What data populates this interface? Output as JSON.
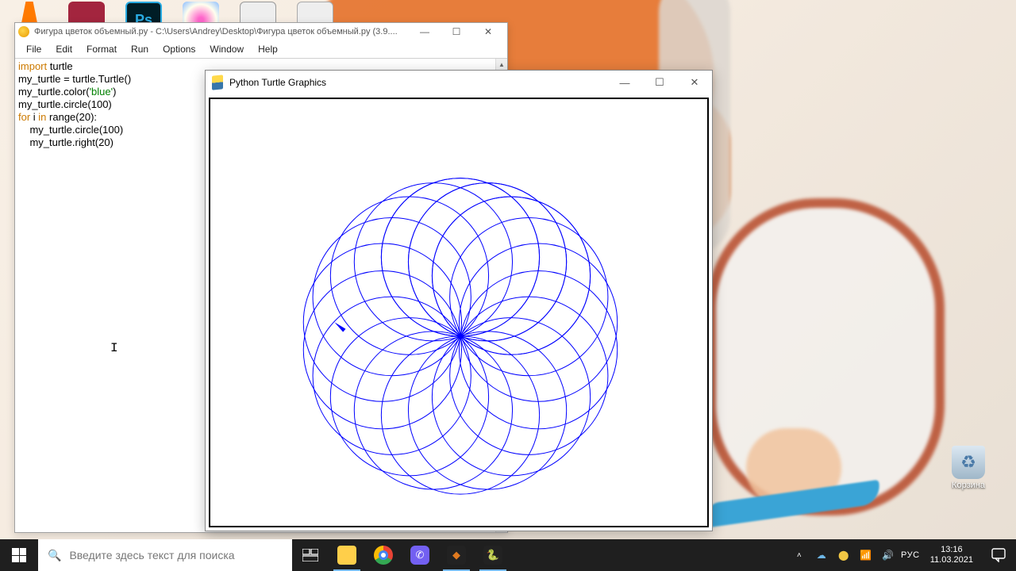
{
  "idle": {
    "title": "Фигура цветок объемный.py - C:\\Users\\Andrey\\Desktop\\Фигура цветок объемный.py (3.9....",
    "menu": {
      "file": "File",
      "edit": "Edit",
      "format": "Format",
      "run": "Run",
      "options": "Options",
      "window": "Window",
      "help": "Help"
    },
    "code": {
      "kw_import": "import",
      "turtle": " turtle",
      "line2": "my_turtle = turtle.Turtle()",
      "line3a": "my_turtle.color(",
      "line3b": "'blue'",
      "line3c": ")",
      "line4": "my_turtle.circle(100)",
      "kw_for": "for",
      "line5b": " i ",
      "kw_in": "in",
      "line5c": " range(20):",
      "line6": "    my_turtle.circle(100)",
      "line7": "    my_turtle.right(20)"
    }
  },
  "turtle_window": {
    "title": "Python Turtle Graphics",
    "graphics": {
      "num_circles": 21,
      "circle_radius": 100,
      "rotation_deg": 20,
      "color": "blue"
    }
  },
  "desktop": {
    "recycle_label": "Корзина"
  },
  "taskbar": {
    "search_placeholder": "Введите здесь текст для поиска",
    "lang": "РУС",
    "time": "13:16",
    "date": "11.03.2021"
  },
  "chart_data": {
    "type": "line",
    "title": "Python Turtle Graphics",
    "series": [
      {
        "name": "circle",
        "radius": 100,
        "heading_deg": 0,
        "color": "blue"
      },
      {
        "name": "circle",
        "radius": 100,
        "heading_deg": -20,
        "color": "blue"
      },
      {
        "name": "circle",
        "radius": 100,
        "heading_deg": -40,
        "color": "blue"
      },
      {
        "name": "circle",
        "radius": 100,
        "heading_deg": -60,
        "color": "blue"
      },
      {
        "name": "circle",
        "radius": 100,
        "heading_deg": -80,
        "color": "blue"
      },
      {
        "name": "circle",
        "radius": 100,
        "heading_deg": -100,
        "color": "blue"
      },
      {
        "name": "circle",
        "radius": 100,
        "heading_deg": -120,
        "color": "blue"
      },
      {
        "name": "circle",
        "radius": 100,
        "heading_deg": -140,
        "color": "blue"
      },
      {
        "name": "circle",
        "radius": 100,
        "heading_deg": -160,
        "color": "blue"
      },
      {
        "name": "circle",
        "radius": 100,
        "heading_deg": -180,
        "color": "blue"
      },
      {
        "name": "circle",
        "radius": 100,
        "heading_deg": -200,
        "color": "blue"
      },
      {
        "name": "circle",
        "radius": 100,
        "heading_deg": -220,
        "color": "blue"
      },
      {
        "name": "circle",
        "radius": 100,
        "heading_deg": -240,
        "color": "blue"
      },
      {
        "name": "circle",
        "radius": 100,
        "heading_deg": -260,
        "color": "blue"
      },
      {
        "name": "circle",
        "radius": 100,
        "heading_deg": -280,
        "color": "blue"
      },
      {
        "name": "circle",
        "radius": 100,
        "heading_deg": -300,
        "color": "blue"
      },
      {
        "name": "circle",
        "radius": 100,
        "heading_deg": -320,
        "color": "blue"
      },
      {
        "name": "circle",
        "radius": 100,
        "heading_deg": -340,
        "color": "blue"
      },
      {
        "name": "circle",
        "radius": 100,
        "heading_deg": -360,
        "color": "blue"
      },
      {
        "name": "circle",
        "radius": 100,
        "heading_deg": -380,
        "color": "blue"
      },
      {
        "name": "circle",
        "radius": 100,
        "heading_deg": -400,
        "color": "blue"
      }
    ]
  }
}
